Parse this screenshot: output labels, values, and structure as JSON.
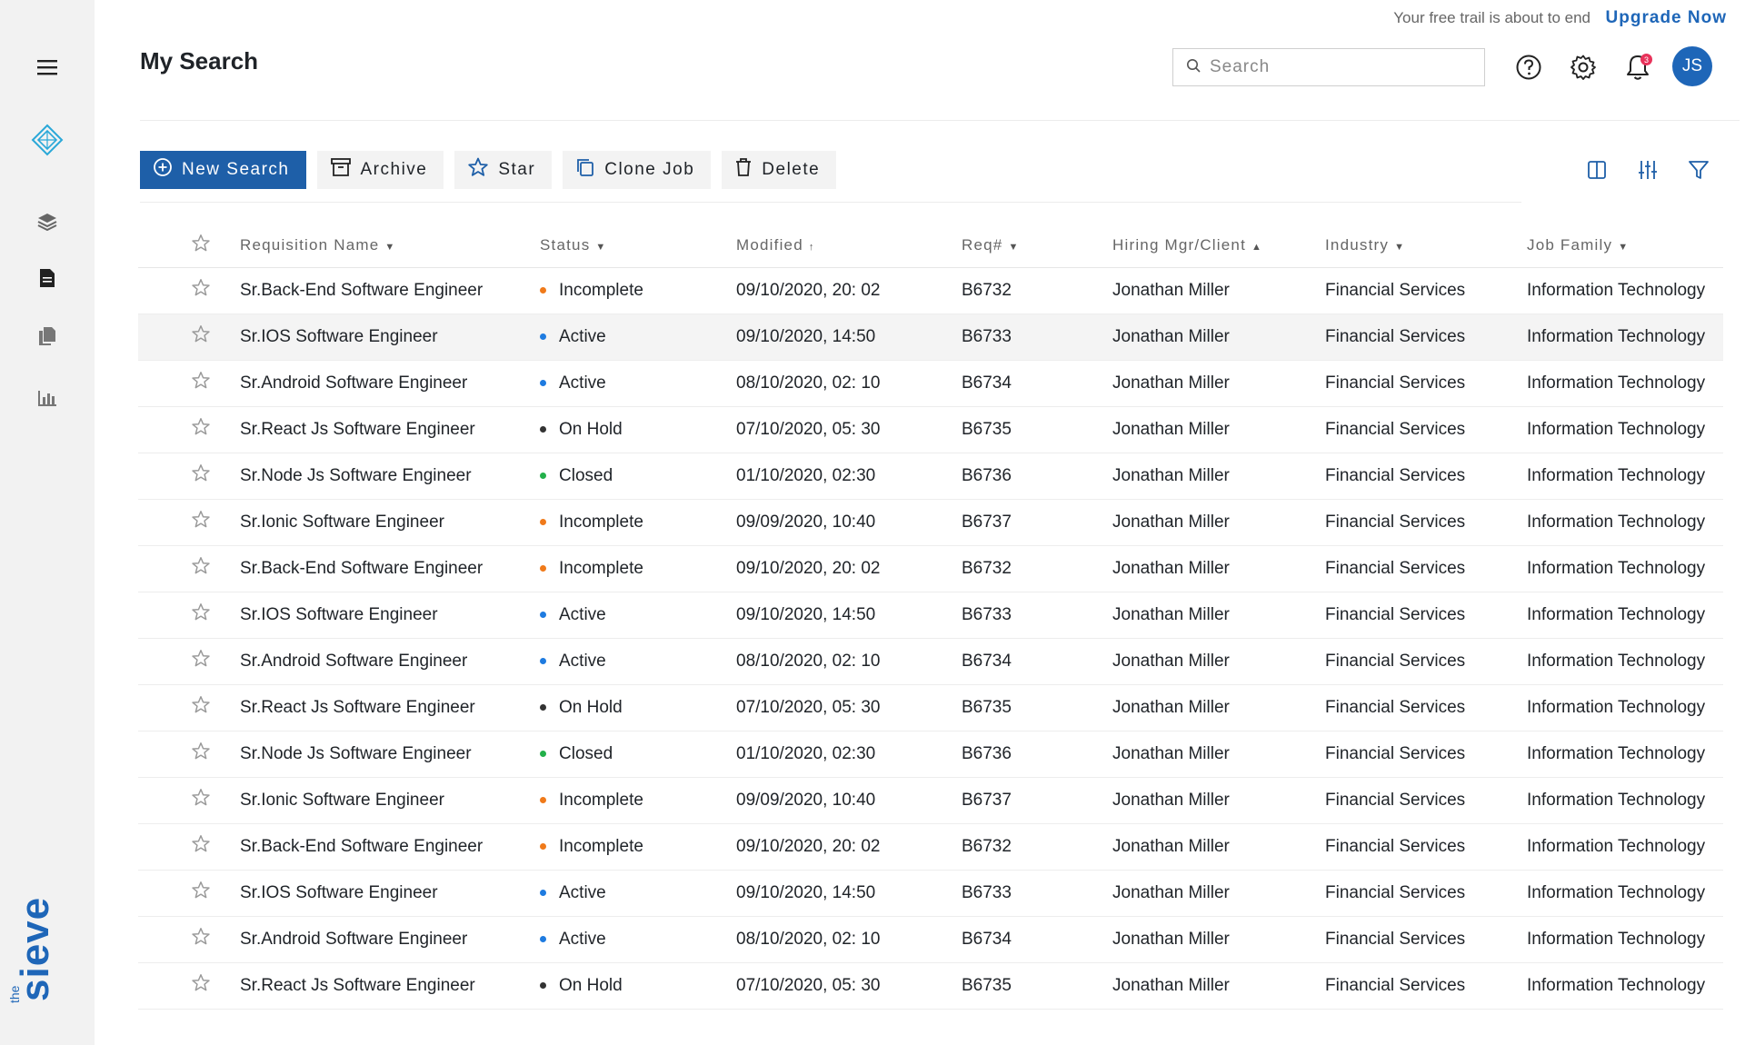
{
  "header": {
    "page_title": "My Search",
    "trial_text": "Your free trail is about to end",
    "upgrade_label": "Upgrade Now",
    "search_placeholder": "Search",
    "notification_count": "3",
    "avatar_initials": "JS"
  },
  "sidebar": {
    "items": [
      {
        "icon": "hamburger-menu-icon"
      },
      {
        "icon": "cube-logo-icon"
      },
      {
        "icon": "layers-icon"
      },
      {
        "icon": "document-icon"
      },
      {
        "icon": "copy-documents-icon"
      },
      {
        "icon": "bar-chart-icon"
      }
    ],
    "brand_small": "the",
    "brand_large": "sieve"
  },
  "toolbar": {
    "new_search": "New Search",
    "archive": "Archive",
    "star": "Star",
    "clone_job": "Clone Job",
    "delete": "Delete"
  },
  "table": {
    "headers": {
      "name": "Requisition Name",
      "status": "Status",
      "modified": "Modified",
      "req": "Req#",
      "mgr": "Hiring Mgr/Client",
      "industry": "Industry",
      "family": "Job Family"
    },
    "status_colors": {
      "Incomplete": "#f07a1a",
      "Active": "#1e7be0",
      "On Hold": "#333333",
      "Closed": "#22b04a"
    },
    "rows": [
      {
        "name": "Sr.Back-End Software Engineer",
        "status": "Incomplete",
        "modified": "09/10/2020, 20: 02",
        "req": "B6732",
        "mgr": "Jonathan Miller",
        "industry": "Financial Services",
        "family": "Information Technology"
      },
      {
        "name": "Sr.IOS Software Engineer",
        "status": "Active",
        "modified": "09/10/2020, 14:50",
        "req": "B6733",
        "mgr": "Jonathan Miller",
        "industry": "Financial Services",
        "family": "Information Technology"
      },
      {
        "name": "Sr.Android Software Engineer",
        "status": "Active",
        "modified": "08/10/2020, 02: 10",
        "req": "B6734",
        "mgr": "Jonathan Miller",
        "industry": "Financial Services",
        "family": "Information Technology"
      },
      {
        "name": "Sr.React Js Software Engineer",
        "status": "On Hold",
        "modified": "07/10/2020, 05: 30",
        "req": "B6735",
        "mgr": "Jonathan Miller",
        "industry": "Financial Services",
        "family": "Information Technology"
      },
      {
        "name": "Sr.Node Js Software Engineer",
        "status": "Closed",
        "modified": "01/10/2020, 02:30",
        "req": "B6736",
        "mgr": "Jonathan Miller",
        "industry": "Financial Services",
        "family": "Information Technology"
      },
      {
        "name": "Sr.Ionic Software Engineer",
        "status": "Incomplete",
        "modified": "09/09/2020, 10:40",
        "req": "B6737",
        "mgr": "Jonathan Miller",
        "industry": "Financial Services",
        "family": "Information Technology"
      },
      {
        "name": "Sr.Back-End Software Engineer",
        "status": "Incomplete",
        "modified": "09/10/2020, 20: 02",
        "req": "B6732",
        "mgr": "Jonathan Miller",
        "industry": "Financial Services",
        "family": "Information Technology"
      },
      {
        "name": "Sr.IOS Software Engineer",
        "status": "Active",
        "modified": "09/10/2020, 14:50",
        "req": "B6733",
        "mgr": "Jonathan Miller",
        "industry": "Financial Services",
        "family": "Information Technology"
      },
      {
        "name": "Sr.Android Software Engineer",
        "status": "Active",
        "modified": "08/10/2020, 02: 10",
        "req": "B6734",
        "mgr": "Jonathan Miller",
        "industry": "Financial Services",
        "family": "Information Technology"
      },
      {
        "name": "Sr.React Js Software Engineer",
        "status": "On Hold",
        "modified": "07/10/2020, 05: 30",
        "req": "B6735",
        "mgr": "Jonathan Miller",
        "industry": "Financial Services",
        "family": "Information Technology"
      },
      {
        "name": "Sr.Node Js Software Engineer",
        "status": "Closed",
        "modified": "01/10/2020, 02:30",
        "req": "B6736",
        "mgr": "Jonathan Miller",
        "industry": "Financial Services",
        "family": "Information Technology"
      },
      {
        "name": "Sr.Ionic Software Engineer",
        "status": "Incomplete",
        "modified": "09/09/2020, 10:40",
        "req": "B6737",
        "mgr": "Jonathan Miller",
        "industry": "Financial Services",
        "family": "Information Technology"
      },
      {
        "name": "Sr.Back-End Software Engineer",
        "status": "Incomplete",
        "modified": "09/10/2020, 20: 02",
        "req": "B6732",
        "mgr": "Jonathan Miller",
        "industry": "Financial Services",
        "family": "Information Technology"
      },
      {
        "name": "Sr.IOS Software Engineer",
        "status": "Active",
        "modified": "09/10/2020, 14:50",
        "req": "B6733",
        "mgr": "Jonathan Miller",
        "industry": "Financial Services",
        "family": "Information Technology"
      },
      {
        "name": "Sr.Android Software Engineer",
        "status": "Active",
        "modified": "08/10/2020, 02: 10",
        "req": "B6734",
        "mgr": "Jonathan Miller",
        "industry": "Financial Services",
        "family": "Information Technology"
      },
      {
        "name": "Sr.React Js Software Engineer",
        "status": "On Hold",
        "modified": "07/10/2020, 05: 30",
        "req": "B6735",
        "mgr": "Jonathan Miller",
        "industry": "Financial Services",
        "family": "Information Technology"
      }
    ]
  },
  "colors": {
    "accent": "#1e5fa8",
    "brand": "#1e66b8",
    "badge": "#e8325a",
    "sidebar_bg": "#f2f2f2"
  }
}
